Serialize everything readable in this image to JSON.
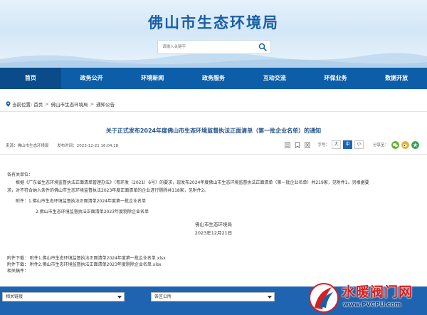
{
  "site": {
    "title": "佛山市生态环境局"
  },
  "search": {
    "placeholder": "请输入关键字"
  },
  "nav": {
    "items": [
      {
        "label": "首页",
        "active": true
      },
      {
        "label": "政务公开"
      },
      {
        "label": "环境新闻"
      },
      {
        "label": "政务服务"
      },
      {
        "label": "互动交流"
      },
      {
        "label": "环保业务"
      },
      {
        "label": "数据开放"
      }
    ]
  },
  "breadcrumb": {
    "prefix": "当前位置:",
    "items": [
      "首页",
      "佛山市生态环境局",
      "通知公告"
    ],
    "separator": ">"
  },
  "article": {
    "title": "关于正式发布2024年度佛山市生态环境监督执法正面清单（第一批企业名单）的通知",
    "source": "来源：佛山市生态环境局",
    "published": "发布时间：2023-12-21 16:04:18",
    "font_size_label": "字号：",
    "font_sizes": [
      "大",
      "中",
      "小"
    ],
    "active_font_size": "中",
    "share_label": "分享至：",
    "greeting": "各有关单位：",
    "paragraph_line1": "根据《广东省生态环境监督执法正面清单管理办法》（粤环发〔2021〕6号）的要求，现发布2024年度佛山市生态环境监督执法正面清单（第一批企业名单）共219家，见附件1。另根据要",
    "paragraph_line2": "求，对不符合纳入条件的佛山市生态环境监督执法2023年度正面清单的企业进行剔除共118家，见附件2。",
    "attachment_list_1": "附件：1.佛山市生态环境监督执法正面清单2024年度第一批企业名单",
    "attachment_list_2": "2.佛山市生态环境监督执法正面清单2023年度剔除企业名单",
    "signature_org": "佛山市生态环境局",
    "signature_date": "2023年12月21日"
  },
  "attachments": {
    "download_1": "附件下载：  附件1.佛山市生态环境监督执法正面清单2024年度第一批企业名单.xlsx",
    "download_2": "附件下载：  附件2.佛山市生态环境监督执法正面清单2023年度剔除企业名单.xlsx",
    "related": "相关稿件："
  },
  "footer": {
    "select_1": "相关链接",
    "select_2": "各区公所"
  },
  "watermark": {
    "text": "水暖阀门网",
    "url": "www.PVCPU.com"
  },
  "colors": {
    "nav_bg": "#0d5ea8",
    "nav_active": "#0a4c8a",
    "title_blue": "#1a5fa6",
    "footer_bg": "#1e64b0",
    "watermark_red": "#d62020"
  }
}
